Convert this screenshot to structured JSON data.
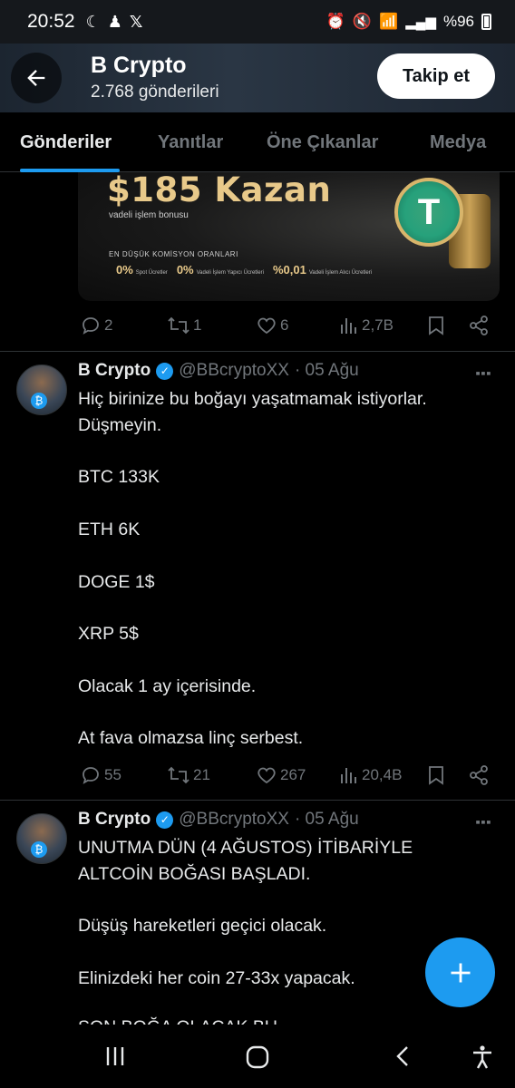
{
  "status_bar": {
    "time": "20:52",
    "battery": "%96"
  },
  "header": {
    "title": "B Crypto",
    "posts_count": "2.768 gönderileri",
    "follow_label": "Takip et"
  },
  "tabs": [
    {
      "label": "Gönderiler",
      "active": true
    },
    {
      "label": "Yanıtlar",
      "active": false
    },
    {
      "label": "Öne Çıkanlar",
      "active": false
    },
    {
      "label": "Medya",
      "active": false
    }
  ],
  "banner": {
    "title": "$185 Kazan",
    "subtitle": "vadeli işlem bonusu",
    "small_title": "EN DÜŞÜK KOMİSYON ORANLARI",
    "stats": [
      {
        "value": "0%",
        "label": "Spot Ücretler"
      },
      {
        "value": "0%",
        "label": "Vadeli İşlem Yapıcı Ücretleri"
      },
      {
        "value": "%0,01",
        "label": "Vadeli İşlem Alıcı Ücretleri"
      }
    ]
  },
  "first_post_actions": {
    "replies": "2",
    "reposts": "1",
    "likes": "6",
    "views": "2,7B"
  },
  "tweets": [
    {
      "name": "B Crypto",
      "handle": "@BBcryptoXX",
      "date": "· 05 Ağu",
      "lines": [
        "Hiç birinize bu boğayı yaşatmamak istiyorlar.",
        "Düşmeyin.",
        "",
        "BTC 133K",
        "",
        "ETH 6K",
        "",
        "DOGE 1$",
        "",
        "XRP 5$",
        "",
        "Olacak 1 ay içerisinde.",
        "",
        "At fava olmazsa linç serbest."
      ],
      "actions": {
        "replies": "55",
        "reposts": "21",
        "likes": "267",
        "views": "20,4B"
      }
    },
    {
      "name": "B Crypto",
      "handle": "@BBcryptoXX",
      "date": "· 05 Ağu",
      "lines": [
        "UNUTMA DÜN (4 AĞUSTOS) İTİBARİYLE",
        "ALTCOİN BOĞASI BAŞLADI.",
        "",
        "Düşüş hareketleri geçici olacak.",
        "",
        "Elinizdeki her coin 27-33x yapacak."
      ],
      "cut_line": "SON BOĞA OLACAK BU"
    }
  ],
  "colors": {
    "accent": "#1d9bf0",
    "background": "#000000",
    "muted": "#71767b",
    "text": "#e7e9ea",
    "divider": "#2f3336"
  }
}
